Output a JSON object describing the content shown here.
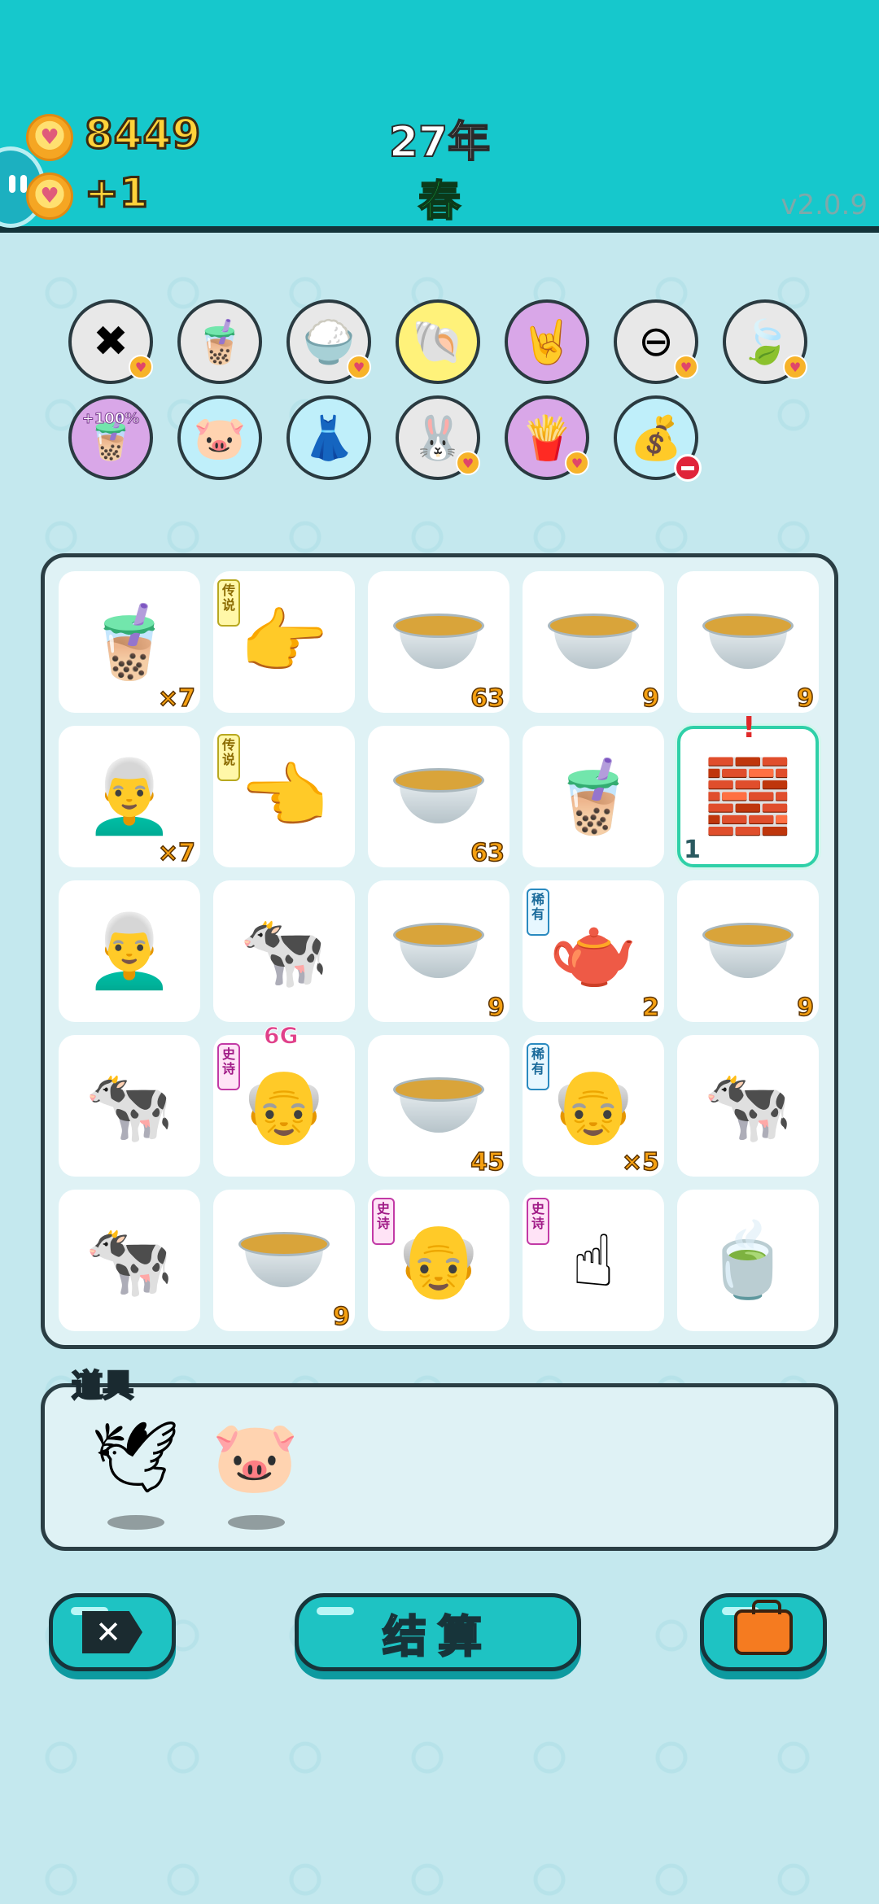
{
  "header": {
    "coins": "8449",
    "income": "+1",
    "year": "27年",
    "season": "春",
    "version": "v2.0.9"
  },
  "upgrades_row1": [
    {
      "icon": "remove-tag-icon",
      "glyph": "✖",
      "bg": "#e8e8e8",
      "heart": true
    },
    {
      "icon": "bubble-tea-lid-icon",
      "glyph": "🧋",
      "bg": "#e8e8e8",
      "heart": false
    },
    {
      "icon": "rice-bowl-icon",
      "glyph": "🍚",
      "bg": "#e8e8e8",
      "heart": true
    },
    {
      "icon": "shell-icon",
      "glyph": "🐚",
      "bg": "#fff27a",
      "heart": false
    },
    {
      "icon": "rock-hand-icon",
      "glyph": "🤘",
      "bg": "#d9a7e8",
      "heart": false
    },
    {
      "icon": "minus-circle-icon",
      "glyph": "⊖",
      "bg": "#e8e8e8",
      "heart": true
    },
    {
      "icon": "leaf-icon",
      "glyph": "🍃",
      "bg": "#e8e8e8",
      "heart": true
    }
  ],
  "upgrades_row2": [
    {
      "icon": "bubble-tea-plus-icon",
      "glyph": "🧋",
      "bg": "#d9a7e8",
      "tag": "+100%"
    },
    {
      "icon": "piggy-bank-icon",
      "glyph": "🐷",
      "bg": "#bfeffa"
    },
    {
      "icon": "skirt-icon",
      "glyph": "👗",
      "bg": "#bfeffa"
    },
    {
      "icon": "rabbit-icon",
      "glyph": "🐰",
      "bg": "#e8e8e8",
      "heart": true
    },
    {
      "icon": "fries-icon",
      "glyph": "🍟",
      "bg": "#d9a7e8",
      "heart": true
    },
    {
      "icon": "bag-icon",
      "glyph": "💰",
      "bg": "#bfeffa",
      "minus": true
    }
  ],
  "board": [
    [
      {
        "icon": "bubble-tea-icon",
        "glyph": "🧋",
        "count": "×7"
      },
      {
        "icon": "pointing-hand-icon",
        "glyph": "👉",
        "badge": "传说",
        "badge_type": "leg"
      },
      {
        "icon": "bowl-icon",
        "kind": "bowl",
        "count": "63"
      },
      {
        "icon": "bowl-icon",
        "kind": "bowl",
        "count": "9"
      },
      {
        "icon": "bowl-icon",
        "kind": "bowl",
        "count": "9"
      }
    ],
    [
      {
        "icon": "old-man-face-icon",
        "glyph": "👨‍🦳",
        "count": "×7"
      },
      {
        "icon": "pointing-hand-icon",
        "glyph": "👈",
        "badge": "传说",
        "badge_type": "leg"
      },
      {
        "icon": "bowl-icon",
        "kind": "bowl",
        "count": "63"
      },
      {
        "icon": "bubble-tea-icon",
        "glyph": "🧋"
      },
      {
        "icon": "gold-bars-icon",
        "glyph": "🧱",
        "selected": true,
        "left": "1",
        "alert": "!"
      }
    ],
    [
      {
        "icon": "old-man-face-icon",
        "glyph": "👨‍🦳"
      },
      {
        "icon": "cow-icon",
        "glyph": "🐄"
      },
      {
        "icon": "bowl-icon",
        "kind": "bowl",
        "count": "9"
      },
      {
        "icon": "teapot-icon",
        "glyph": "🫖",
        "badge": "稀有",
        "badge_type": "rare",
        "count": "2"
      },
      {
        "icon": "bowl-icon",
        "kind": "bowl",
        "count": "9"
      }
    ],
    [
      {
        "icon": "cow-icon",
        "glyph": "🐄"
      },
      {
        "icon": "bald-man-face-icon",
        "glyph": "👴",
        "badge": "史诗",
        "badge_type": "epic",
        "top": "6G"
      },
      {
        "icon": "bowl-icon",
        "kind": "bowl",
        "count": "45"
      },
      {
        "icon": "bald-man-face-icon",
        "glyph": "👴",
        "badge": "稀有",
        "badge_type": "rare",
        "count": "×5"
      },
      {
        "icon": "cow-icon",
        "glyph": "🐄"
      }
    ],
    [
      {
        "icon": "cow-icon",
        "glyph": "🐄"
      },
      {
        "icon": "bowl-icon",
        "kind": "bowl",
        "count": "9"
      },
      {
        "icon": "bald-man-face-icon",
        "glyph": "👴",
        "badge": "史诗",
        "badge_type": "epic"
      },
      {
        "icon": "pointing-finger-icon",
        "glyph": "☝",
        "badge": "史诗",
        "badge_type": "epic"
      },
      {
        "icon": "tea-bag-icon",
        "glyph": "🍵"
      }
    ]
  ],
  "items_panel": {
    "label": "道具",
    "items": [
      {
        "icon": "bird-icon",
        "glyph": "🕊"
      },
      {
        "icon": "piggy-bank-icon",
        "glyph": "🐷"
      }
    ]
  },
  "buttons": {
    "settle_label": "结算"
  }
}
